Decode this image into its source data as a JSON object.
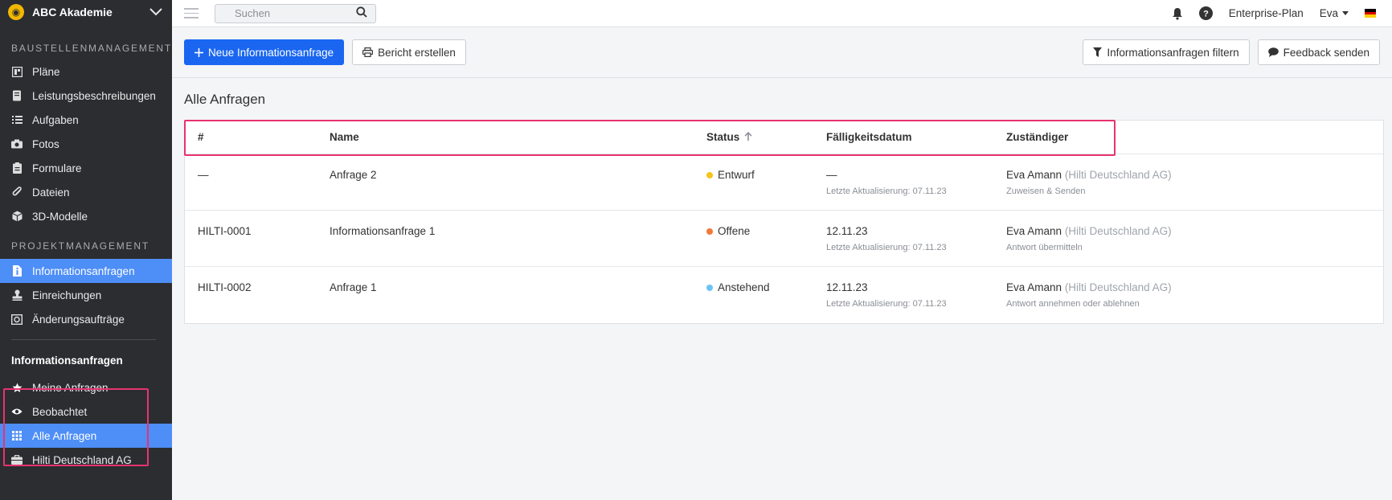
{
  "sidebar": {
    "brand": "ABC Akademie",
    "section1": "BAUSTELLENMANAGEMENT",
    "section1_items": [
      {
        "label": "Pläne",
        "icon": "plans-icon"
      },
      {
        "label": "Leistungsbeschreibungen",
        "icon": "book-icon"
      },
      {
        "label": "Aufgaben",
        "icon": "list-icon"
      },
      {
        "label": "Fotos",
        "icon": "camera-icon"
      },
      {
        "label": "Formulare",
        "icon": "clipboard-icon"
      },
      {
        "label": "Dateien",
        "icon": "paperclip-icon"
      },
      {
        "label": "3D-Modelle",
        "icon": "cube-icon"
      }
    ],
    "section2": "PROJEKTMANAGEMENT",
    "section2_items": [
      {
        "label": "Informationsanfragen",
        "icon": "info-doc-icon",
        "active": true
      },
      {
        "label": "Einreichungen",
        "icon": "stamp-icon"
      },
      {
        "label": "Änderungsaufträge",
        "icon": "change-order-icon"
      }
    ],
    "subsection_title": "Informationsanfragen",
    "subsection_items": [
      {
        "label": "Meine Anfragen",
        "icon": "star-icon"
      },
      {
        "label": "Beobachtet",
        "icon": "eye-icon"
      },
      {
        "label": "Alle Anfragen",
        "icon": "grid-icon",
        "active": true
      },
      {
        "label": "Hilti Deutschland AG",
        "icon": "briefcase-icon"
      }
    ]
  },
  "topbar": {
    "search_placeholder": "Suchen",
    "plan": "Enterprise-Plan",
    "user": "Eva"
  },
  "toolbar": {
    "new_request": "Neue Informationsanfrage",
    "create_report": "Bericht erstellen",
    "filter": "Informationsanfragen filtern",
    "feedback": "Feedback senden"
  },
  "main": {
    "title": "Alle Anfragen",
    "columns": {
      "num": "#",
      "name": "Name",
      "status": "Status",
      "due": "Fälligkeitsdatum",
      "assignee": "Zuständiger"
    },
    "rows": [
      {
        "num": "—",
        "name": "Anfrage 2",
        "status": "Entwurf",
        "status_color": "#f5c518",
        "due": "—",
        "updated": "Letzte Aktualisierung: 07.11.23",
        "assignee": "Eva Amann",
        "company": "(Hilti Deutschland AG)",
        "action": "Zuweisen & Senden"
      },
      {
        "num": "HILTI-0001",
        "name": "Informationsanfrage 1",
        "status": "Offene",
        "status_color": "#f07a3a",
        "due": "12.11.23",
        "updated": "Letzte Aktualisierung: 07.11.23",
        "assignee": "Eva Amann",
        "company": "(Hilti Deutschland AG)",
        "action": "Antwort übermitteln"
      },
      {
        "num": "HILTI-0002",
        "name": "Anfrage 1",
        "status": "Anstehend",
        "status_color": "#6cc3f5",
        "due": "12.11.23",
        "updated": "Letzte Aktualisierung: 07.11.23",
        "assignee": "Eva Amann",
        "company": "(Hilti Deutschland AG)",
        "action": "Antwort annehmen oder ablehnen"
      }
    ]
  }
}
